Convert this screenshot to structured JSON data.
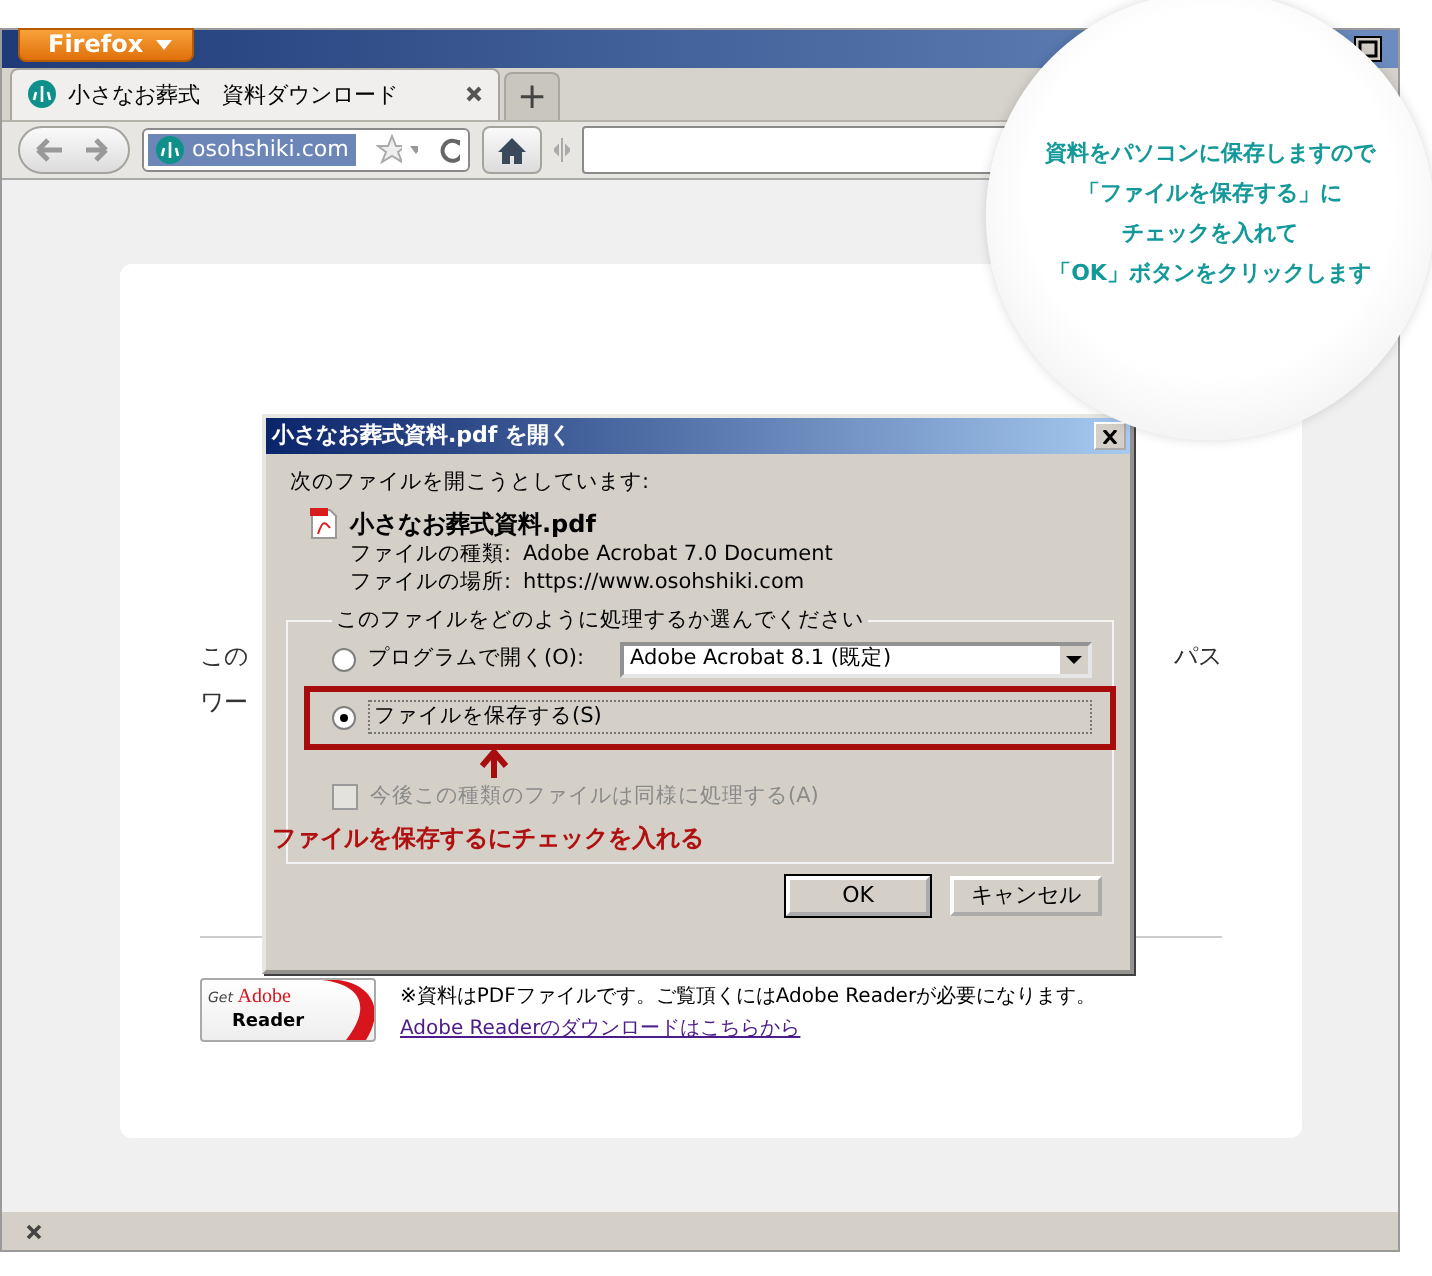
{
  "browser": {
    "menu_button": "Firefox",
    "tabs": [
      {
        "label": "小さなお葬式　資料ダウンロード",
        "selected": true
      }
    ],
    "new_tab": "+",
    "address": "osohshiki.com"
  },
  "page": {
    "paragraph_left": [
      "この",
      "ワー"
    ],
    "paragraph_right": "パス",
    "badge": {
      "get": "Get",
      "adobe": "Adobe",
      "reader": "Reader"
    },
    "note": "※資料はPDFファイルです。ご覧頂くにはAdobe Readerが必要になります。",
    "link": "Adobe Readerのダウンロードはこちらから"
  },
  "dialog": {
    "title": "小さなお葬式資料.pdf を開く",
    "intro": "次のファイルを開こうとしています:",
    "file_name": "小さなお葬式資料.pdf",
    "details": [
      {
        "label": "ファイルの種類:",
        "value": "Adobe Acrobat 7.0 Document"
      },
      {
        "label": "ファイルの場所:",
        "value": "https://www.osohshiki.com"
      }
    ],
    "group_label": "このファイルをどのように処理するか選んでください",
    "options": [
      {
        "label": "プログラムで開く(O):",
        "selected": false,
        "select": "Adobe Acrobat 8.1 (既定)"
      },
      {
        "label": "ファイルを保存する(S)",
        "selected": true
      }
    ],
    "remember": {
      "label": "今後この種類のファイルは同様に処理する(A)",
      "checked": false,
      "disabled": true
    },
    "buttons": [
      "OK",
      "キャンセル"
    ]
  },
  "annotation": {
    "instruction": "ファイルを保存するにチェックを入れる",
    "callout": [
      "資料をパソコンに保存しますので",
      "「ファイルを保存する」に",
      "チェックを入れて",
      "「OK」ボタンをクリックします"
    ]
  }
}
